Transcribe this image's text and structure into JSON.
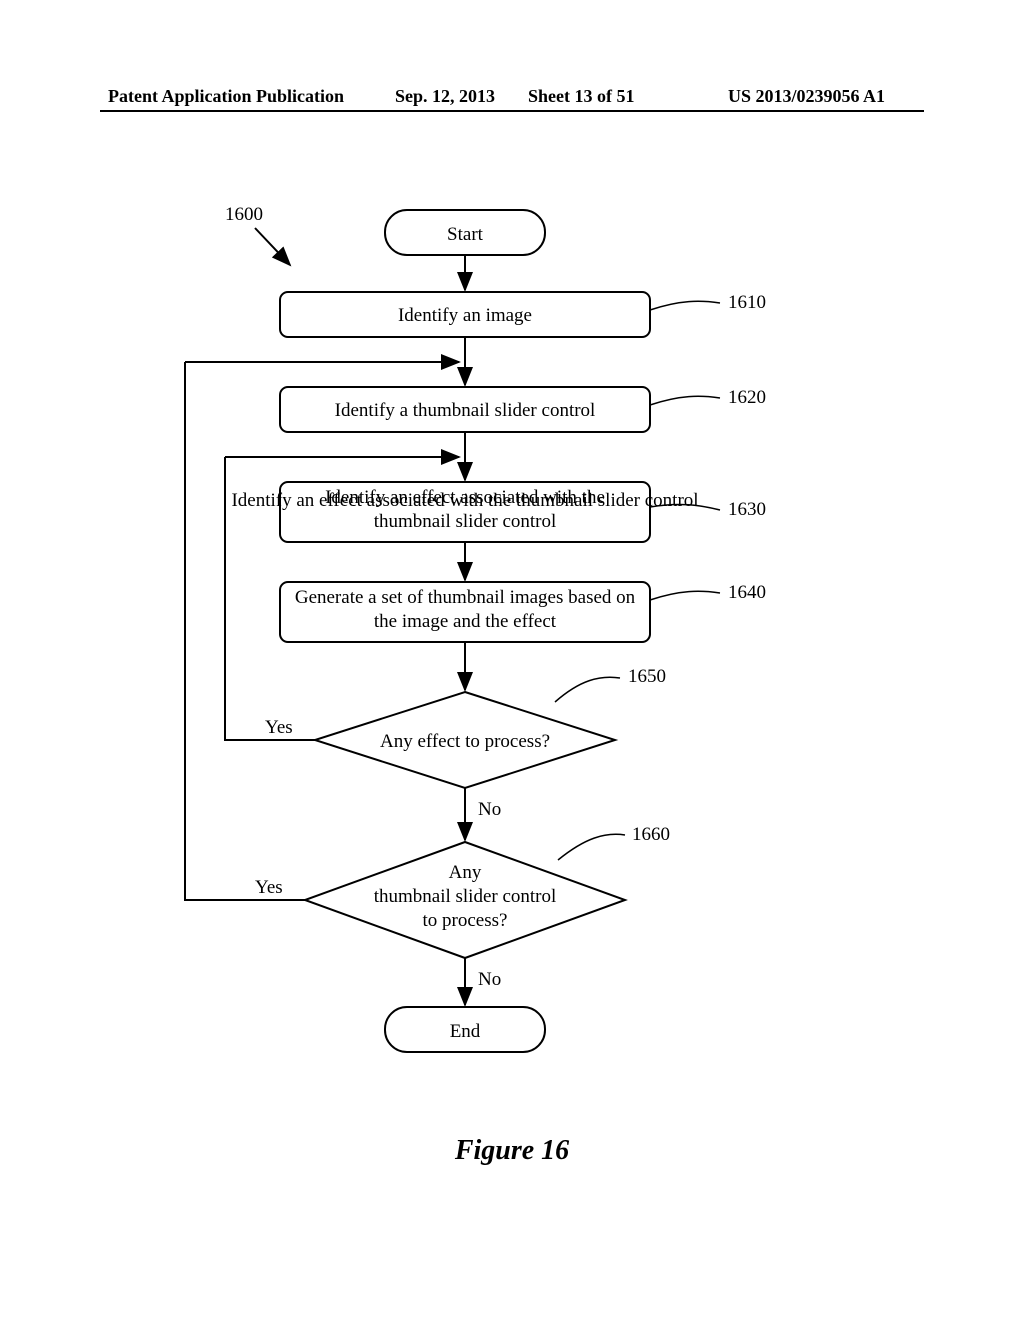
{
  "header": {
    "pubType": "Patent Application Publication",
    "date": "Sep. 12, 2013",
    "sheet": "Sheet 13 of 51",
    "appNumber": "US 2013/0239056 A1"
  },
  "figure": {
    "caption": "Figure 16",
    "refTop": "1600",
    "nodes": {
      "start": "Start",
      "step1": "Identify an image",
      "step2": "Identify a thumbnail slider control",
      "step3": "Identify an effect associated with the thumbnail slider control",
      "step4": "Generate a set of thumbnail images based on the image and the effect",
      "decision1": "Any effect to process?",
      "decision2_l1": "Any",
      "decision2_l2": "thumbnail slider control",
      "decision2_l3": "to process?",
      "end": "End"
    },
    "refs": {
      "r1610": "1610",
      "r1620": "1620",
      "r1630": "1630",
      "r1640": "1640",
      "r1650": "1650",
      "r1660": "1660"
    },
    "labels": {
      "yes": "Yes",
      "no": "No"
    }
  }
}
